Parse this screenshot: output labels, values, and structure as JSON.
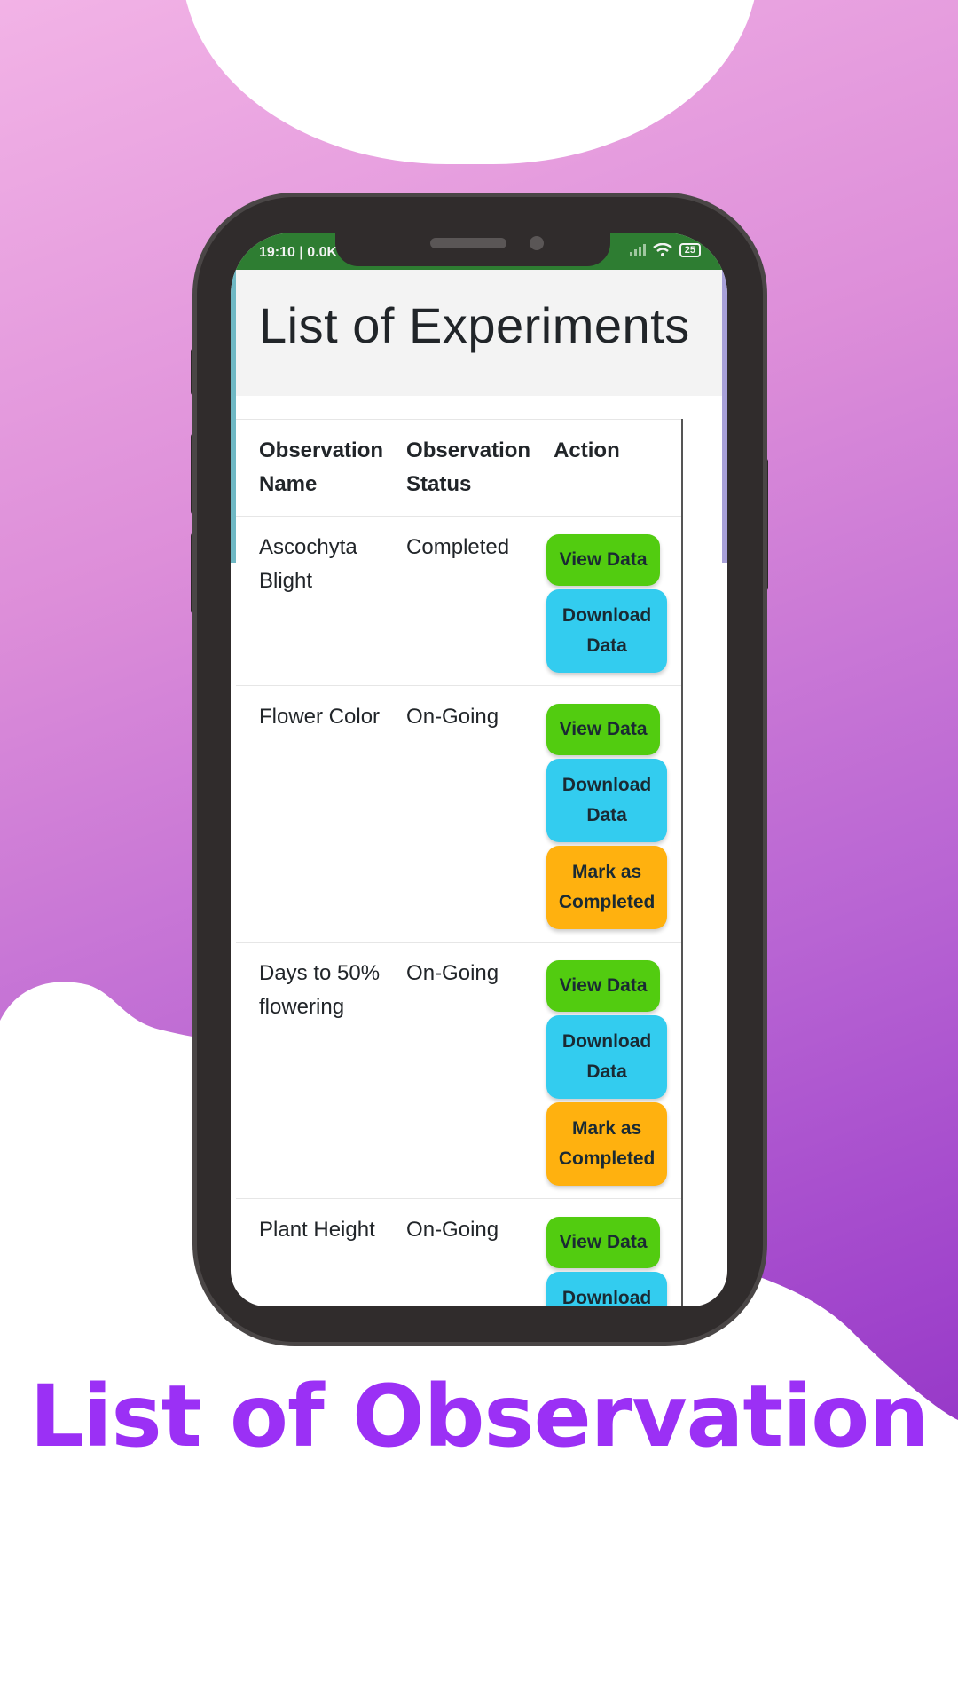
{
  "status_bar": {
    "time": "19:10 | 0.0K",
    "battery": "25",
    "signal_icon": "signal-icon",
    "wifi_icon": "wifi-icon",
    "battery_icon": "battery-icon"
  },
  "header": {
    "title": "List of Experiments"
  },
  "table": {
    "columns": [
      "Observation Name",
      "Observation Status",
      "Action"
    ],
    "rows": [
      {
        "name": "Ascochyta Blight",
        "status": "Completed",
        "actions": [
          "View Data",
          "Download Data"
        ]
      },
      {
        "name": "Flower Color",
        "status": "On-Going",
        "actions": [
          "View Data",
          "Download Data",
          "Mark as Completed"
        ]
      },
      {
        "name": "Days to 50% flowering",
        "status": "On-Going",
        "actions": [
          "View Data",
          "Download Data",
          "Mark as Completed"
        ]
      },
      {
        "name": "Plant Height",
        "status": "On-Going",
        "actions": [
          "View Data",
          "Download Data"
        ]
      }
    ]
  },
  "caption": "List of Observation",
  "colors": {
    "view_button": "#52cc10",
    "download_button": "#33ccef",
    "mark_button": "#ffb10f",
    "status_bar": "#2e7d32",
    "caption": "#9b30f5"
  }
}
